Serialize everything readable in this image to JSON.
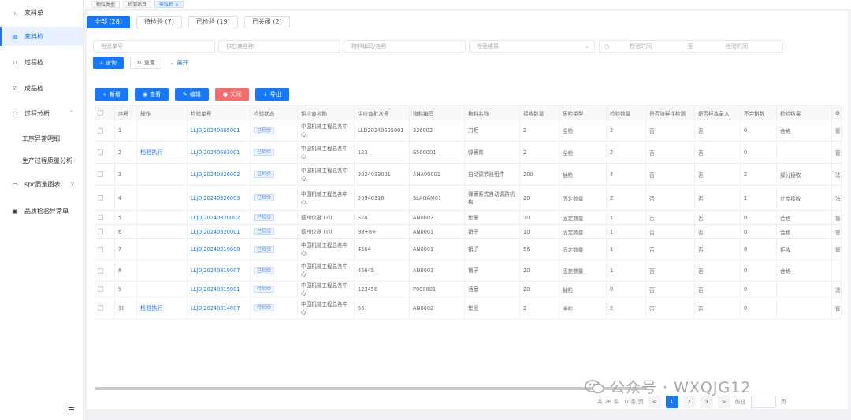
{
  "sidebar": {
    "items": [
      {
        "label": "来料单",
        "icon": "chevron-right-icon",
        "active": false,
        "sub": false,
        "arrow": ""
      },
      {
        "label": "来料检",
        "icon": "clipboard-icon",
        "active": true,
        "sub": false,
        "arrow": ""
      },
      {
        "label": "过程检",
        "icon": "cart-icon",
        "active": false,
        "sub": false,
        "arrow": ""
      },
      {
        "label": "成品检",
        "icon": "check-box-icon",
        "active": false,
        "sub": false,
        "arrow": ""
      },
      {
        "label": "过程分析",
        "icon": "search-icon",
        "active": false,
        "sub": false,
        "arrow": "^"
      },
      {
        "label": "工序异常明细",
        "icon": "",
        "active": false,
        "sub": true,
        "arrow": ""
      },
      {
        "label": "生产过程质量分析",
        "icon": "",
        "active": false,
        "sub": true,
        "arrow": ""
      },
      {
        "label": "spc质量图表",
        "icon": "monitor-icon",
        "active": false,
        "sub": false,
        "arrow": "v"
      },
      {
        "label": "品质检验异常单",
        "icon": "doc-icon",
        "active": false,
        "sub": false,
        "arrow": ""
      }
    ],
    "menu_icon": "≡"
  },
  "tags": [
    {
      "label": "物料类型",
      "active": false
    },
    {
      "label": "检测项目",
      "active": false
    },
    {
      "label": "来料检 ×",
      "active": true
    }
  ],
  "status_tabs": [
    {
      "label": "全部 (28)",
      "active": true
    },
    {
      "label": "待检验 (7)",
      "active": false
    },
    {
      "label": "已检验 (19)",
      "active": false
    },
    {
      "label": "已关闭 (2)",
      "active": false
    }
  ],
  "filters": {
    "inspection_no": "检验单号",
    "supplier": "供应商名称",
    "material": "物料编码/名称",
    "inspection_status": "检验结果",
    "date_start": "检验时间",
    "date_sep": "至",
    "date_end": "检验时间"
  },
  "actions": {
    "query": "查询",
    "reset": "重置",
    "expand": "展开"
  },
  "toolbar": {
    "add": "新增",
    "view": "查看",
    "edit": "编辑",
    "close": "关闭",
    "export": "导出"
  },
  "table": {
    "headers": [
      "",
      "序号",
      "操作",
      "检验单号",
      "检验状态",
      "供应商名称",
      "供应商批次号",
      "物料编码",
      "物料名称",
      "接收数量",
      "质检类型",
      "检验数量",
      "是否随样性检测",
      "是否样本录入",
      "不合格数",
      "检验结果",
      "⚙"
    ],
    "rows": [
      [
        "",
        "1",
        "",
        "LLJDJ20240605001",
        "已检验",
        "中国机械工程总各中心",
        "LLD20240605001",
        "326002",
        "刀柜",
        "2",
        "全检",
        "2",
        "否",
        "否",
        "0",
        "合格",
        "管"
      ],
      [
        "",
        "2",
        "检验执行",
        "LLJDJ20240603001",
        "已检验",
        "中国机械工程总各中心",
        "123",
        "S500001",
        "弹簧育",
        "2",
        "全检",
        "2",
        "否",
        "否",
        "0",
        "",
        "管"
      ],
      [
        "",
        "3",
        "",
        "LLJDJ20240326002",
        "已检验",
        "中国机械工程总各中心",
        "2024033001",
        "AHA00001",
        "自动调节器组件",
        "200",
        "抽检",
        "4",
        "否",
        "否",
        "2",
        "部分接收",
        "法"
      ],
      [
        "",
        "4",
        "",
        "LLJDJ20240326003",
        "已检验",
        "中国机械工程总各中心",
        "20940316",
        "SLAGAM01",
        "弹簧素式自动调路机构",
        "20",
        "固定数量",
        "2",
        "否",
        "否",
        "1",
        "让步接收",
        "法"
      ],
      [
        "",
        "5",
        "",
        "LLJDJ20240320002",
        "已检验",
        "德州仪器 (TI)",
        "S24",
        "AN0002",
        "垫圈",
        "10",
        "固定数量",
        "1",
        "否",
        "否",
        "0",
        "合格",
        "管"
      ],
      [
        "",
        "6",
        "",
        "LLJDJ20240320001",
        "已检验",
        "德州仪器 (TI)",
        "98+8+",
        "AN0001",
        "销子",
        "10",
        "固定数量",
        "1",
        "否",
        "否",
        "0",
        "合格",
        "管"
      ],
      [
        "",
        "7",
        "",
        "LLJDJ20240319008",
        "已检验",
        "中国机械工程总各中心",
        "4564",
        "AN0001",
        "销子",
        "56",
        "固定数量",
        "1",
        "否",
        "否",
        "0",
        "拒收",
        "管"
      ],
      [
        "",
        "8",
        "",
        "LLJDJ20240319007",
        "已检验",
        "中国机械工程总各中心",
        "45645",
        "AN0001",
        "销子",
        "20",
        "固定数量",
        "1",
        "否",
        "否",
        "0",
        "合格",
        ""
      ],
      [
        "",
        "9",
        "",
        "LLJDJ20240315001",
        "待检验",
        "中国机械工程总各中心",
        "123456",
        "P000001",
        "活塞",
        "20",
        "抽检",
        "0",
        "否",
        "否",
        "0",
        "",
        "法"
      ],
      [
        "",
        "10",
        "检验执行",
        "LLJDJ20240314007",
        "待检验",
        "中国机械工程总各中心",
        "56",
        "AN0002",
        "垫圈",
        "2",
        "全检",
        "2",
        "否",
        "否",
        "0",
        "",
        "管"
      ]
    ]
  },
  "pager": {
    "total": "共 28 条",
    "page_size": "10条/页",
    "pages": [
      "<",
      "1",
      "2",
      "3",
      ">"
    ],
    "goto": "前往",
    "page_unit": "页"
  },
  "watermark": "公众号 · WXQJG12"
}
